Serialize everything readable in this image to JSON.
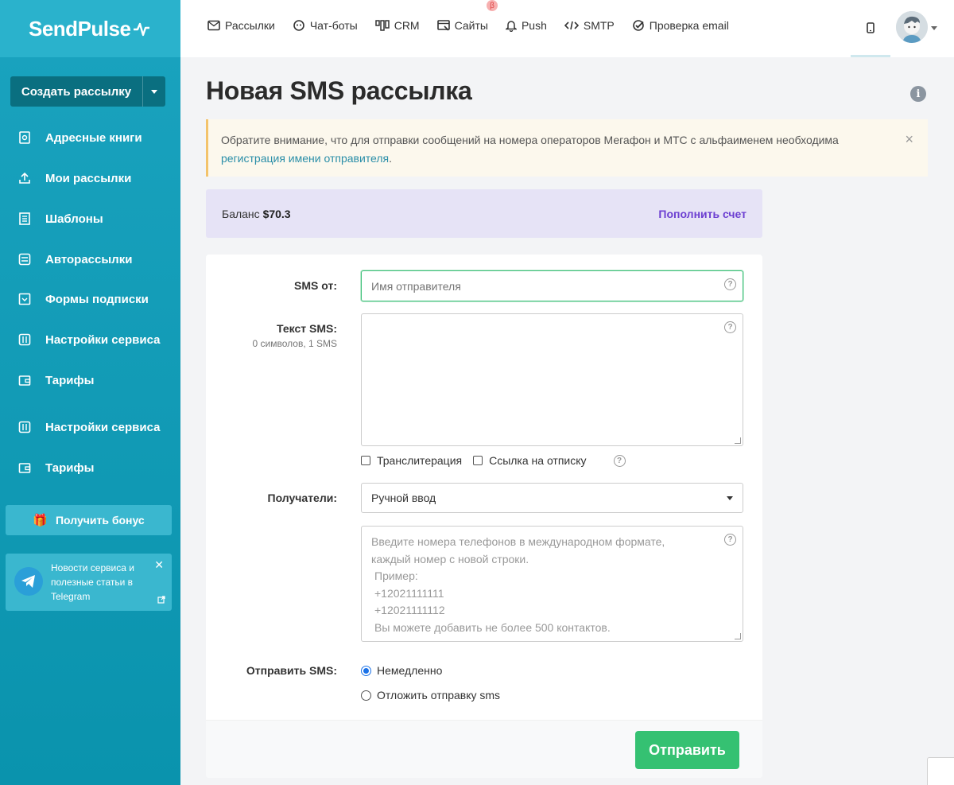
{
  "brand": {
    "name": "SendPulse"
  },
  "sidebar": {
    "create_label": "Создать рассылку",
    "items": [
      {
        "label": "Адресные книги",
        "icon": "address-book-icon"
      },
      {
        "label": "Мои рассылки",
        "icon": "campaigns-icon"
      },
      {
        "label": "Шаблоны",
        "icon": "templates-icon"
      },
      {
        "label": "Авторассылки",
        "icon": "automation-icon"
      },
      {
        "label": "Формы подписки",
        "icon": "forms-icon"
      },
      {
        "label": "Настройки сервиса",
        "icon": "settings-icon"
      },
      {
        "label": "Тарифы",
        "icon": "wallet-icon"
      },
      {
        "label": "Настройки сервиса",
        "icon": "settings-icon"
      },
      {
        "label": "Тарифы",
        "icon": "wallet-icon"
      }
    ],
    "bonus_label": "Получить бонус",
    "telegram_text": "Новости сервиса и полезные статьи в Telegram"
  },
  "topnav": {
    "items": [
      {
        "label": "Рассылки",
        "icon": "mail-icon"
      },
      {
        "label": "Чат-боты",
        "icon": "chatbot-icon"
      },
      {
        "label": "CRM",
        "icon": "crm-icon"
      },
      {
        "label": "Сайты",
        "icon": "sites-icon",
        "badge": "β"
      },
      {
        "label": "Push",
        "icon": "bell-icon"
      },
      {
        "label": "SMTP",
        "icon": "code-icon"
      },
      {
        "label": "Проверка email",
        "icon": "check-circle-icon"
      }
    ]
  },
  "page": {
    "title": "Новая SMS рассылка",
    "alert_text": "Обратите внимание, что для отправки сообщений на номера операторов Мегафон и МТС с альфаименем необходима ",
    "alert_link": "регистрация имени отправителя",
    "alert_end": ".",
    "balance_label": "Баланс ",
    "balance_value": "$70.3",
    "topup_label": "Пополнить счет"
  },
  "form": {
    "sender_label": "SMS от:",
    "sender_placeholder": "Имя отправителя",
    "text_label": "Текст SMS:",
    "text_counter": "0 символов, 1 SMS",
    "translit_label": "Транслитерация",
    "unsub_label": "Ссылка на отписку",
    "recipients_label": "Получатели:",
    "recipients_value": "Ручной ввод",
    "phones_placeholder": [
      "Введите номера телефонов в международном формате,",
      "каждый номер с новой строки.",
      " Пример:",
      " +12021111111",
      " +12021111112",
      " Вы можете добавить не более 500 контактов."
    ],
    "send_label": "Отправить SMS:",
    "send_now": "Немедленно",
    "send_later": "Отложить отправку sms",
    "submit": "Отправить"
  },
  "colors": {
    "sidebar": "#1aa3bf",
    "accent_green": "#35c172",
    "link_purple": "#6c3fd1"
  }
}
